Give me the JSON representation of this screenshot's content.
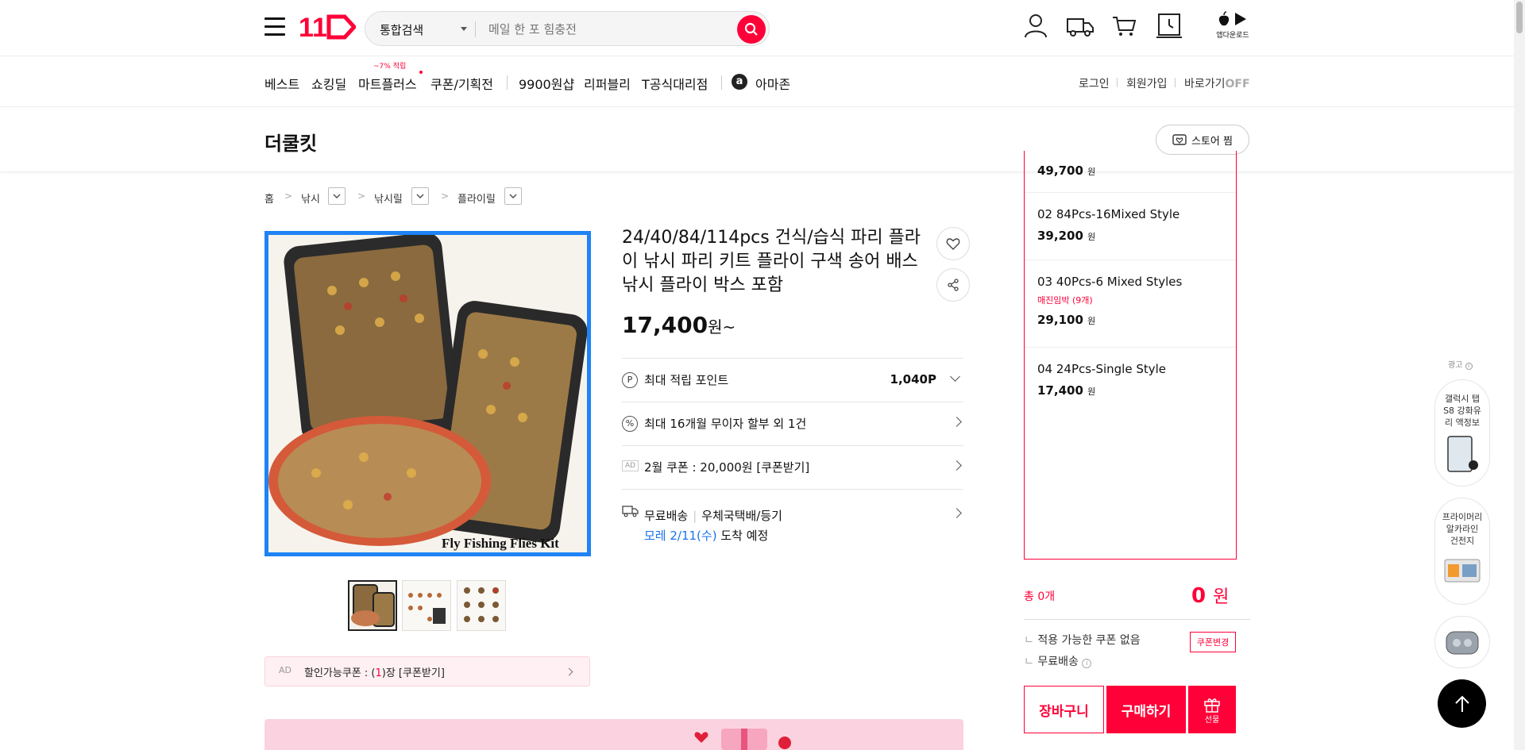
{
  "header": {
    "search_category": "통합검색",
    "search_placeholder": "메일 한 포 힘충전",
    "app_download": "앱다운로드"
  },
  "nav": {
    "items": [
      "베스트",
      "쇼킹딜",
      "마트플러스",
      "쿠폰/기획전",
      "9900원샵",
      "리퍼블리",
      "T공식대리점",
      "아마존"
    ],
    "mart_badge": "~7% 적립",
    "util": {
      "login": "로그인",
      "join": "회원가입",
      "shortcut": "바로가기",
      "shortcut_state": "OFF"
    }
  },
  "store": {
    "name": "더쿨킷",
    "fav_label": "스토어 찜"
  },
  "breadcrumb": [
    "홈",
    "낚시",
    "낚시릴",
    "플라이릴"
  ],
  "product": {
    "title": "24/40/84/114pcs 건식/습식 파리 플라이 낚시 파리 키트 플라이 구색 송어 배스 낚시 플라이 박스 포함",
    "price": "17,400",
    "price_unit": "원~",
    "image_caption": "Fly Fishing Flies Kit",
    "rows": {
      "points_label": "최대 적립 포인트",
      "points_value": "1,040P",
      "installment": "최대 16개월 무이자 할부 외 1건",
      "ad_tag": "AD",
      "coupon": "2월 쿠폰 : 20,000원 [쿠폰받기]",
      "delivery_free": "무료배송",
      "delivery_method": "우체국택배/등기",
      "arrival_date": "모레 2/11(수)",
      "arrival_suffix": "도착 예정"
    },
    "coupon_bar": {
      "ad": "AD",
      "text_prefix": "할인가능쿠폰 : (",
      "count": "1",
      "text_suffix": ")장 [쿠폰받기]"
    }
  },
  "options": {
    "partial_price": "49,700",
    "items": [
      {
        "name": "02 84Pcs-16Mixed Style",
        "price": "39,200",
        "warning": ""
      },
      {
        "name": "03 40Pcs-6 Mixed Styles",
        "price": "29,100",
        "warning": "매진임박 (9개)"
      },
      {
        "name": "04 24Pcs-Single Style",
        "price": "17,400",
        "warning": ""
      }
    ],
    "won": "원"
  },
  "summary": {
    "total_label": "총 0개",
    "total_value": "0",
    "total_unit": "원",
    "no_coupon": "적용 가능한 쿠폰 없음",
    "free_shipping": "무료배송",
    "coupon_change": "쿠폰변경",
    "cart": "장바구니",
    "buy": "구매하기",
    "gift": "선물"
  },
  "side_ads": {
    "label": "광고",
    "ad1": "갤럭시 탭 S8 강화유리 액정보",
    "ad2": "프라이머리 알카라인 건전지"
  },
  "colors": {
    "brand": "#ff0038",
    "image_border": "#1e83f5",
    "link": "#1a73e8"
  }
}
